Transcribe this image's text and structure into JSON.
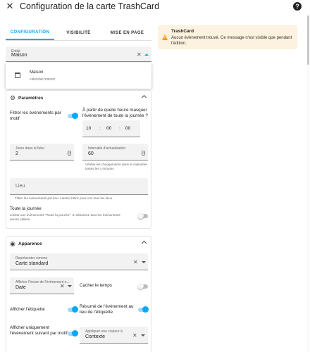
{
  "dialog": {
    "title": "Configuration de la carte TrashCard"
  },
  "tabs": [
    {
      "label": "Configuration"
    },
    {
      "label": "Visibilité"
    },
    {
      "label": "Mise en page"
    }
  ],
  "entity": {
    "label": "Entité",
    "value": "Maison"
  },
  "dropdown": {
    "title": "Maison",
    "subtitle": "calendar.maison"
  },
  "parameters": {
    "title": "Paramètres",
    "filter_events_label": "Filtrer les évènements par motif",
    "hide_after_label": "À partir de quelle heure masquer l'évènement de toute la journée ?",
    "time": {
      "hours": "10",
      "minutes": "00",
      "seconds": "00"
    },
    "days_future": {
      "label": "Jours dans le futur",
      "value": "2"
    },
    "refresh_interval": {
      "label": "Intervalle d'actualisation",
      "value": "60"
    },
    "refresh_hint": "Vérifier les changements dans le calendrier toutes les x minutes",
    "location": {
      "label": "Lieu"
    },
    "location_hint": "Filtrer les évènements par lieu. Laisser blanc pour voir tous les lieux.",
    "all_day_label": "Toute la journée",
    "all_day_hint": "Limiter aux évènements \"Toute la journée\". Si désactivé tous les évènements seront utilisés."
  },
  "appearance": {
    "title": "Apparence",
    "display_as": {
      "label": "Représenter comme",
      "value": "Carte standard"
    },
    "event_time": {
      "label": "Afficher l'heure de l'évènement e...",
      "value": "Date"
    },
    "hide_time_label": "Cacher le temps",
    "show_label_label": "Afficher l'étiquette",
    "summary_label": "Résumé de l'évènement au lieu de l'étiquette",
    "show_only_label": "Afficher uniquement l'évènement suivant par motif",
    "apply_color": {
      "label": "Appliquer une couleur à",
      "value": "Contexte"
    }
  },
  "alert": {
    "title": "TrashCard",
    "message": "Aucun évènement trouvé. Ce message n'est visible que pendant l'édition."
  },
  "colors": {
    "accent": "#03a9f4",
    "warning": "#ff9800",
    "alert_bg": "#fdf1df"
  }
}
